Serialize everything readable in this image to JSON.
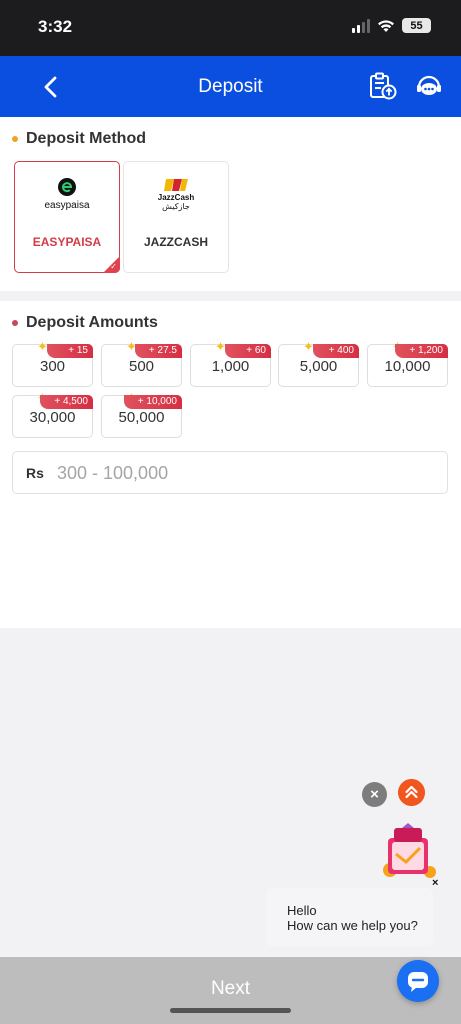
{
  "status_bar": {
    "time": "3:32",
    "battery": "55"
  },
  "header": {
    "title": "Deposit"
  },
  "deposit_method": {
    "title": "Deposit Method",
    "methods": [
      {
        "name": "EASYPAISA",
        "logo_text": "easypaisa",
        "selected": true
      },
      {
        "name": "JAZZCASH",
        "logo_text": "JazzCash",
        "logo_text_2": "جازکیش",
        "selected": false
      }
    ]
  },
  "deposit_amounts": {
    "title": "Deposit Amounts",
    "options": [
      {
        "value": "300",
        "bonus": "+ 15"
      },
      {
        "value": "500",
        "bonus": "+ 27.5"
      },
      {
        "value": "1,000",
        "bonus": "+ 60"
      },
      {
        "value": "5,000",
        "bonus": "+ 400"
      },
      {
        "value": "10,000",
        "bonus": "+ 1,200"
      },
      {
        "value": "30,000",
        "bonus": "+ 4,500"
      },
      {
        "value": "50,000",
        "bonus": "+ 10,000"
      }
    ],
    "currency": "Rs",
    "placeholder": "300 - 100,000"
  },
  "chat": {
    "line1": "Hello",
    "line2": "How can we help you?"
  },
  "footer": {
    "next_label": "Next"
  },
  "colors": {
    "header_blue": "#0a4fe0",
    "accent_red": "#d43c47",
    "orange": "#f2561f",
    "chat_blue": "#1a6ff2"
  },
  "icons": [
    "back-arrow-icon",
    "deposit-record-icon",
    "customer-support-icon",
    "close-icon",
    "scroll-top-icon",
    "gift-icon",
    "chat-icon"
  ]
}
